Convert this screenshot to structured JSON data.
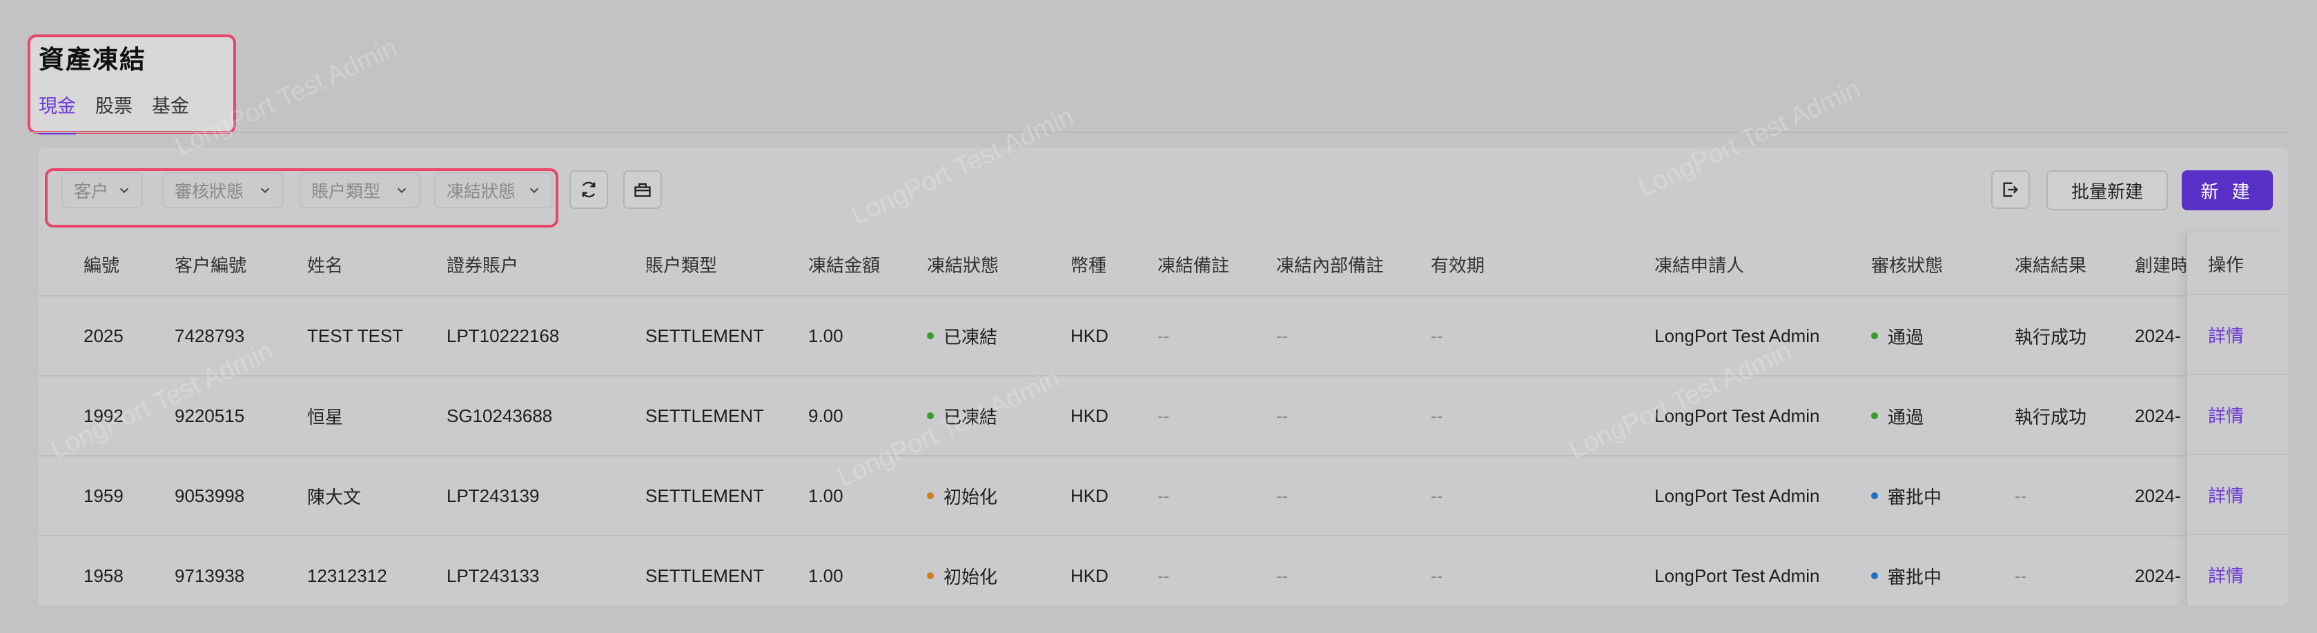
{
  "header": {
    "title": "資產凍結",
    "tabs": [
      {
        "label": "現金",
        "active": true
      },
      {
        "label": "股票",
        "active": false
      },
      {
        "label": "基金",
        "active": false
      }
    ]
  },
  "toolbar": {
    "filters": [
      {
        "label": "客户"
      },
      {
        "label": "審核狀態"
      },
      {
        "label": "賬户類型"
      },
      {
        "label": "凍結狀態"
      }
    ],
    "refresh_icon": "refresh-icon",
    "basket_icon": "basket-icon",
    "export_icon": "export-icon",
    "batch_new_label": "批量新建",
    "new_label": "新 建"
  },
  "table": {
    "columns": [
      "編號",
      "客户編號",
      "姓名",
      "證券賬户",
      "賬户類型",
      "凍結金額",
      "凍結狀態",
      "幣種",
      "凍結備註",
      "凍結內部備註",
      "有效期",
      "凍結申請人",
      "審核狀態",
      "凍結結果",
      "創建時",
      "操作"
    ],
    "rows": [
      {
        "id": "2025",
        "client_no": "7428793",
        "name": "TEST TEST",
        "account": "LPT10222168",
        "acct_type": "SETTLEMENT",
        "amount": "1.00",
        "freeze_status": "已凍結",
        "freeze_status_color": "#3d9a2e",
        "currency": "HKD",
        "remark": "--",
        "internal_remark": "--",
        "validity": "--",
        "applicant": "LongPort Test Admin",
        "review_status": "通過",
        "review_status_color": "#3d9a2e",
        "result": "執行成功",
        "created": "2024-",
        "action": "詳情"
      },
      {
        "id": "1992",
        "client_no": "9220515",
        "name": "恒星",
        "account": "SG10243688",
        "acct_type": "SETTLEMENT",
        "amount": "9.00",
        "freeze_status": "已凍結",
        "freeze_status_color": "#3d9a2e",
        "currency": "HKD",
        "remark": "--",
        "internal_remark": "--",
        "validity": "--",
        "applicant": "LongPort Test Admin",
        "review_status": "通過",
        "review_status_color": "#3d9a2e",
        "result": "執行成功",
        "created": "2024-",
        "action": "詳情"
      },
      {
        "id": "1959",
        "client_no": "9053998",
        "name": "陳大文",
        "account": "LPT243139",
        "acct_type": "SETTLEMENT",
        "amount": "1.00",
        "freeze_status": "初始化",
        "freeze_status_color": "#d1801e",
        "currency": "HKD",
        "remark": "--",
        "internal_remark": "--",
        "validity": "--",
        "applicant": "LongPort Test Admin",
        "review_status": "審批中",
        "review_status_color": "#1f6fc4",
        "result": "--",
        "created": "2024-",
        "action": "詳情"
      },
      {
        "id": "1958",
        "client_no": "9713938",
        "name": "12312312",
        "account": "LPT243133",
        "acct_type": "SETTLEMENT",
        "amount": "1.00",
        "freeze_status": "初始化",
        "freeze_status_color": "#d1801e",
        "currency": "HKD",
        "remark": "--",
        "internal_remark": "--",
        "validity": "--",
        "applicant": "LongPort Test Admin",
        "review_status": "審批中",
        "review_status_color": "#1f6fc4",
        "result": "--",
        "created": "2024-",
        "action": "詳情"
      }
    ]
  },
  "watermark_text": "LongPort Test Admin",
  "colors": {
    "accent": "#6b3ad6",
    "primary_button": "#5930c5",
    "highlight_border": "#e8466a"
  }
}
